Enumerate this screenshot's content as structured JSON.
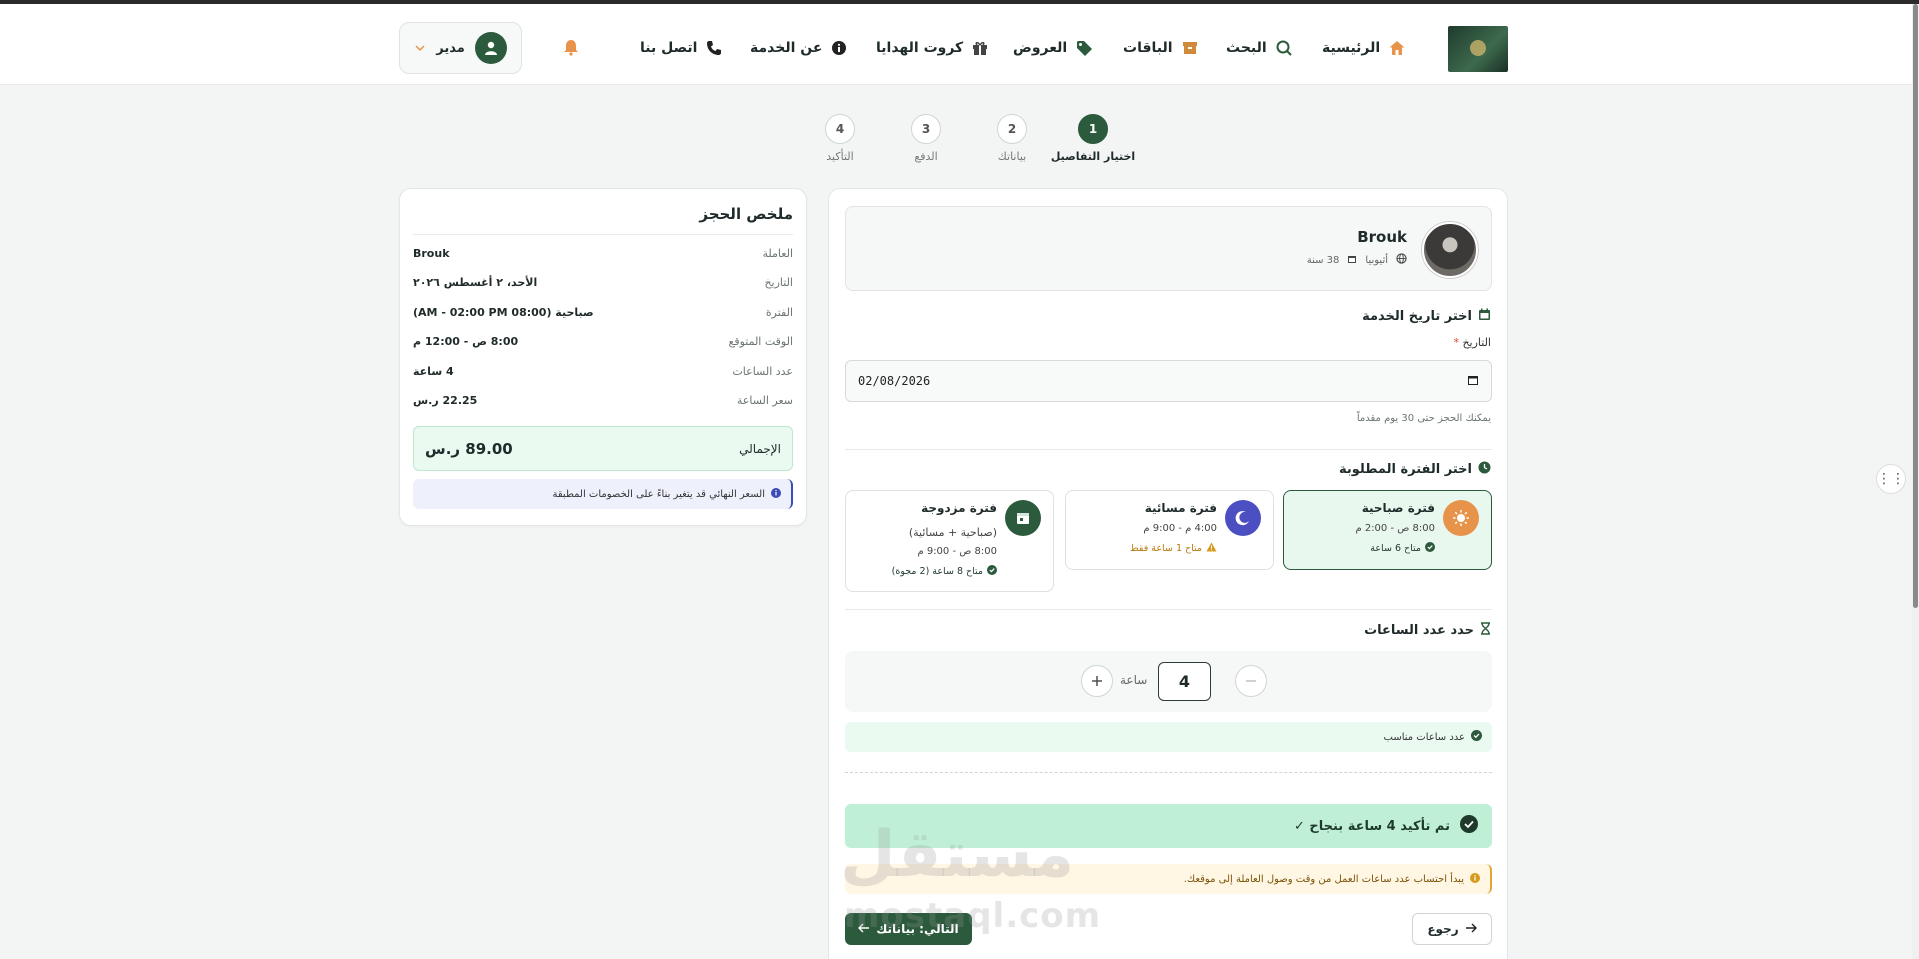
{
  "nav": {
    "items": [
      {
        "label": "الرئيسية",
        "icon": "home-icon",
        "color": "#e8934a"
      },
      {
        "label": "البحث",
        "icon": "search-icon",
        "color": "#2b5a3c"
      },
      {
        "label": "الباقات",
        "icon": "box-icon",
        "color": "#d08a3a"
      },
      {
        "label": "العروض",
        "icon": "tag-icon",
        "color": "#2b5a3c"
      },
      {
        "label": "كروت الهدايا",
        "icon": "gift-icon",
        "color": "#444444"
      },
      {
        "label": "عن الخدمة",
        "icon": "info-icon",
        "color": "#222222"
      },
      {
        "label": "اتصل بنا",
        "icon": "phone-icon",
        "color": "#222222"
      }
    ],
    "user_label": "مدير",
    "bell_color": "#e8934a"
  },
  "steps": [
    {
      "num": "1",
      "label": "اختيار التفاصيل",
      "active": true
    },
    {
      "num": "2",
      "label": "بياناتك",
      "active": false
    },
    {
      "num": "3",
      "label": "الدفع",
      "active": false
    },
    {
      "num": "4",
      "label": "التأكيد",
      "active": false
    }
  ],
  "summary": {
    "title": "ملخص الحجز",
    "rows": [
      {
        "key": "العاملة",
        "value": "Brouk"
      },
      {
        "key": "التاريخ",
        "value": "الأحد، ٢ أغسطس ٢٠٢٦"
      },
      {
        "key": "الفترة",
        "value": "صباحية (08:00 AM - 02:00 PM)"
      },
      {
        "key": "الوقت المتوقع",
        "value": "8:00 ص - 12:00 م"
      },
      {
        "key": "عدد الساعات",
        "value": "4 ساعة"
      },
      {
        "key": "سعر الساعة",
        "value": "22.25 ر.س"
      }
    ],
    "total_label": "الإجمالي",
    "total_value": "89.00 ر.س",
    "note": "السعر النهائي قد يتغير بناءً على الخصومات المطبقة"
  },
  "worker": {
    "name": "Brouk",
    "nationality": "أثيوبيا",
    "age": "38 سنة"
  },
  "date_section": {
    "title": "اختر تاريخ الخدمة",
    "field_label": "التاريخ",
    "required_mark": "*",
    "value": "02/08/2026",
    "hint": "يمكنك الحجز حتى 30 يوم مقدماً"
  },
  "period_section": {
    "title": "اختر الفترة المطلوبة",
    "periods": [
      {
        "title": "فترة صباحية",
        "time": "8:00 ص - 2:00 م",
        "avail": "متاح 6 ساعة",
        "avail_color": "#1f3a2c",
        "icon_bg": "#e8934a",
        "selected": true
      },
      {
        "title": "فترة مسائية",
        "time": "4:00 م - 9:00 م",
        "avail": "متاح 1 ساعة فقط",
        "avail_color": "#b7790f",
        "icon_bg": "#4b4fc2",
        "selected": false
      },
      {
        "title": "فترة مزدوجة",
        "subtitle": "(صباحية + مسائية)",
        "time": "8:00 ص - 9:00 م",
        "avail": "متاح 8 ساعة (2 مجوة)",
        "avail_color": "#1f3a2c",
        "icon_bg": "#2b5a3c",
        "selected": false
      }
    ]
  },
  "hours_section": {
    "title": "حدد عدد الساعات",
    "value": "4",
    "unit": "ساعة",
    "ok_text": "عدد ساعات مناسب"
  },
  "confirm_text": "تم تأكيد 4 ساعة بنجاح ✓",
  "warn_text": "يبدأ احتساب عدد ساعات العمل من وقت وصول العاملة إلى موقعك.",
  "buttons": {
    "back": "رجوع",
    "next": "التالي: بياناتك"
  },
  "watermark": {
    "big": "مستقل",
    "small": "mostaql.com"
  },
  "colors": {
    "primary": "#2b5a3c",
    "accent": "#e8934a",
    "success_bg": "#eafaf1",
    "confirm_bg": "#bff0d6"
  }
}
